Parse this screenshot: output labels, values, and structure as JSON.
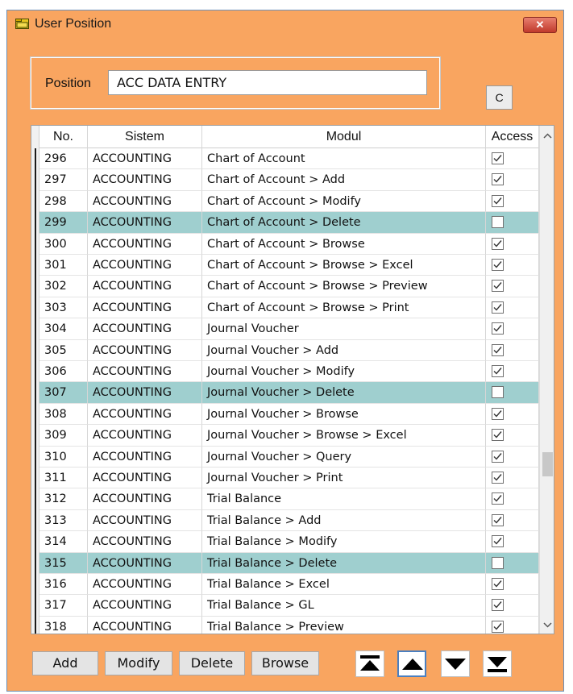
{
  "window": {
    "title": "User Position",
    "close_label": "✕"
  },
  "position": {
    "label": "Position",
    "value": "ACC DATA ENTRY"
  },
  "c_button": {
    "label": "C"
  },
  "grid": {
    "columns": [
      "No.",
      "Sistem",
      "Modul",
      "Access"
    ],
    "rows": [
      {
        "no": "296",
        "sistem": "ACCOUNTING",
        "modul": "Chart of Account",
        "access": true,
        "selected": false
      },
      {
        "no": "297",
        "sistem": "ACCOUNTING",
        "modul": "Chart of Account > Add",
        "access": true,
        "selected": false
      },
      {
        "no": "298",
        "sistem": "ACCOUNTING",
        "modul": "Chart of Account > Modify",
        "access": true,
        "selected": false
      },
      {
        "no": "299",
        "sistem": "ACCOUNTING",
        "modul": "Chart of Account > Delete",
        "access": false,
        "selected": true
      },
      {
        "no": "300",
        "sistem": "ACCOUNTING",
        "modul": "Chart of Account > Browse",
        "access": true,
        "selected": false
      },
      {
        "no": "301",
        "sistem": "ACCOUNTING",
        "modul": "Chart of Account > Browse > Excel",
        "access": true,
        "selected": false
      },
      {
        "no": "302",
        "sistem": "ACCOUNTING",
        "modul": "Chart of Account > Browse > Preview",
        "access": true,
        "selected": false
      },
      {
        "no": "303",
        "sistem": "ACCOUNTING",
        "modul": "Chart of Account > Browse > Print",
        "access": true,
        "selected": false
      },
      {
        "no": "304",
        "sistem": "ACCOUNTING",
        "modul": "Journal Voucher",
        "access": true,
        "selected": false
      },
      {
        "no": "305",
        "sistem": "ACCOUNTING",
        "modul": "Journal Voucher > Add",
        "access": true,
        "selected": false
      },
      {
        "no": "306",
        "sistem": "ACCOUNTING",
        "modul": "Journal Voucher > Modify",
        "access": true,
        "selected": false
      },
      {
        "no": "307",
        "sistem": "ACCOUNTING",
        "modul": "Journal Voucher > Delete",
        "access": false,
        "selected": true
      },
      {
        "no": "308",
        "sistem": "ACCOUNTING",
        "modul": "Journal Voucher > Browse",
        "access": true,
        "selected": false
      },
      {
        "no": "309",
        "sistem": "ACCOUNTING",
        "modul": "Journal Voucher > Browse > Excel",
        "access": true,
        "selected": false
      },
      {
        "no": "310",
        "sistem": "ACCOUNTING",
        "modul": "Journal Voucher > Query",
        "access": true,
        "selected": false
      },
      {
        "no": "311",
        "sistem": "ACCOUNTING",
        "modul": "Journal Voucher > Print",
        "access": true,
        "selected": false
      },
      {
        "no": "312",
        "sistem": "ACCOUNTING",
        "modul": "Trial Balance",
        "access": true,
        "selected": false
      },
      {
        "no": "313",
        "sistem": "ACCOUNTING",
        "modul": "Trial Balance > Add",
        "access": true,
        "selected": false
      },
      {
        "no": "314",
        "sistem": "ACCOUNTING",
        "modul": "Trial Balance > Modify",
        "access": true,
        "selected": false
      },
      {
        "no": "315",
        "sistem": "ACCOUNTING",
        "modul": "Trial Balance > Delete",
        "access": false,
        "selected": true
      },
      {
        "no": "316",
        "sistem": "ACCOUNTING",
        "modul": "Trial Balance > Excel",
        "access": true,
        "selected": false
      },
      {
        "no": "317",
        "sistem": "ACCOUNTING",
        "modul": "Trial Balance > GL",
        "access": true,
        "selected": false
      },
      {
        "no": "318",
        "sistem": "ACCOUNTING",
        "modul": "Trial Balance > Preview",
        "access": true,
        "selected": false
      }
    ]
  },
  "buttons": {
    "add": "Add",
    "modify": "Modify",
    "delete": "Delete",
    "browse": "Browse"
  },
  "nav_icons": [
    "first-record-icon",
    "previous-record-icon",
    "next-record-icon",
    "last-record-icon"
  ],
  "colors": {
    "window_bg": "#f9a560",
    "selected_row": "#9fcfcf",
    "close_button": "#c0392b"
  }
}
